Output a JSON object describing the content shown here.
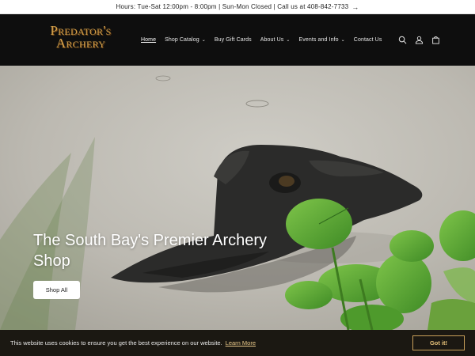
{
  "announcement": {
    "text": "Hours: Tue-Sat 12:00pm - 8:00pm | Sun-Mon Closed | Call us at 408-842-7733",
    "arrow_icon": "arrow-right-icon"
  },
  "header": {
    "logo": {
      "line1": "Predator's",
      "line2": "Archery"
    },
    "nav": {
      "home": "Home",
      "shop_catalog": "Shop Catalog",
      "gift_cards": "Buy Gift Cards",
      "about": "About Us",
      "events": "Events and Info",
      "contact": "Contact Us"
    },
    "icons": [
      "search-icon",
      "account-icon",
      "cart-icon"
    ]
  },
  "hero": {
    "title": "The South Bay's Premier Archery Shop",
    "button_label": "Shop All"
  },
  "cookie_bar": {
    "message": "This website uses cookies to ensure you get the best experience on our website.",
    "link": "Learn More",
    "button": "Got it!"
  },
  "colors": {
    "header_bg": "#0e0e0e",
    "logo_gold": "#d4a24c",
    "cookie_bg": "#1b1812",
    "cookie_accent": "#e7c27a"
  }
}
